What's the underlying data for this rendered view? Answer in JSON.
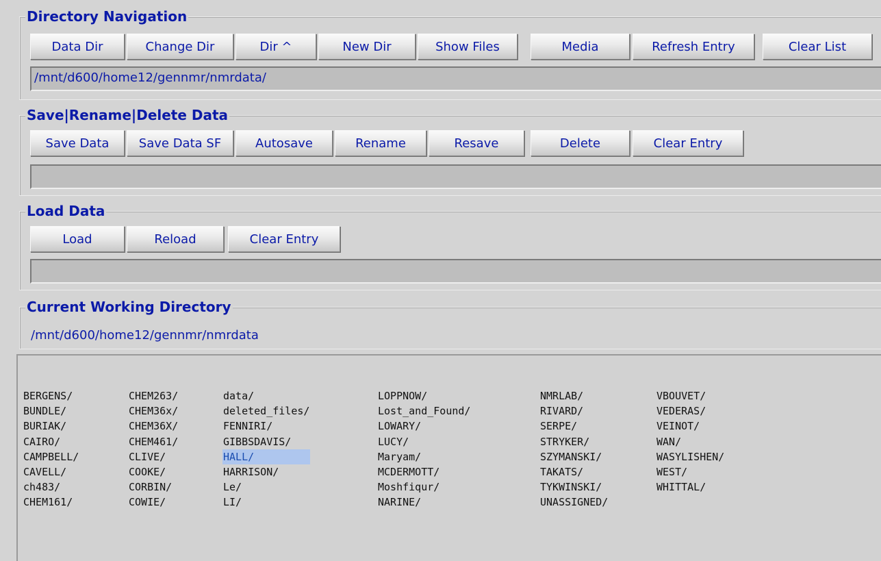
{
  "directory_navigation": {
    "title": "Directory Navigation",
    "buttons": [
      "Data Dir",
      "Change Dir",
      "Dir ^",
      "New Dir",
      "Show Files",
      "Media",
      "Refresh Entry",
      "Clear List"
    ],
    "path_value": "/mnt/d600/home12/gennmr/nmrdata/"
  },
  "save_rename_delete": {
    "title": "Save|Rename|Delete Data",
    "buttons": [
      "Save Data",
      "Save Data SF",
      "Autosave",
      "Rename",
      "Resave",
      "Delete",
      "Clear Entry"
    ],
    "entry_value": ""
  },
  "load_data": {
    "title": "Load Data",
    "buttons": [
      "Load",
      "Reload",
      "Clear Entry"
    ],
    "entry_value": ""
  },
  "current_working_directory": {
    "title": "Current Working Directory",
    "value": "/mnt/d600/home12/gennmr/nmrdata"
  },
  "file_listing": {
    "selected": "HALL/",
    "columns": [
      [
        "BERGENS/",
        "BUNDLE/",
        "BURIAK/",
        "CAIRO/",
        "CAMPBELL/",
        "CAVELL/",
        "ch483/",
        "CHEM161/"
      ],
      [
        "CHEM263/",
        "CHEM36x/",
        "CHEM36X/",
        "CHEM461/",
        "CLIVE/",
        "COOKE/",
        "CORBIN/",
        "COWIE/"
      ],
      [
        "data/",
        "deleted_files/",
        "FENNIRI/",
        "GIBBSDAVIS/",
        "HALL/",
        "HARRISON/",
        "Le/",
        "LI/"
      ],
      [
        "LOPPNOW/",
        "Lost_and_Found/",
        "LOWARY/",
        "LUCY/",
        "Maryam/",
        "MCDERMOTT/",
        "Moshfiqur/",
        "NARINE/"
      ],
      [
        "NMRLAB/",
        "RIVARD/",
        "SERPE/",
        "STRYKER/",
        "SZYMANSKI/",
        "TAKATS/",
        "TYKWINSKI/",
        "UNASSIGNED/"
      ],
      [
        "VBOUVET/",
        "VEDERAS/",
        "VEINOT/",
        "WAN/",
        "WASYLISHEN/",
        "WEST/",
        "WHITTAL/"
      ]
    ]
  }
}
